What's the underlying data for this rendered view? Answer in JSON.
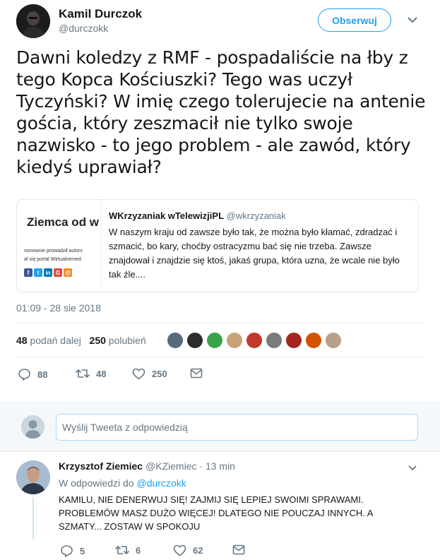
{
  "tweet": {
    "author_name": "Kamil Durczok",
    "author_handle": "@durczokk",
    "follow_label": "Obserwuj",
    "text": "Dawni koledzy z RMF - pospadaliście na łby z tego Kopca Kościuszki? Tego was uczył Tyczyński? W imię czego tolerujecie na antenie gościa, który zeszmacił nie tylko swoje nazwisko - to jego problem - ale zawód, który kiedyś uprawiał?",
    "timestamp": "01:09 - 28 sie 2018",
    "retweets_count": "48",
    "retweets_label": "podań dalej",
    "likes_count": "250",
    "likes_label": "polubień",
    "actions": {
      "replies": "88",
      "retweets": "48",
      "likes": "250"
    }
  },
  "quoted": {
    "thumbnail_title": "Ziemca od w",
    "thumbnail_line1": "nonownie prowadził autors",
    "thumbnail_line2": "al się portal Wirtualnemed",
    "author_name": "WKrzyzaniak wTelewizjiPL",
    "author_handle": "@wkrzyzaniak",
    "text": "W naszym kraju od zawsze było tak, że można było kłamać, zdradzać i szmacić, bo kary, choćby ostracyzmu bać się nie trzeba. Zawsze znajdował i znajdzie się ktoś, jakaś grupa, która uzna, że wcale nie było tak źle...."
  },
  "reply_box": {
    "placeholder": "Wyślij Tweeta z odpowiedzią"
  },
  "reply": {
    "author_name": "Krzysztof Ziemiec",
    "author_handle": "@KZiemiec",
    "time": "· 13 min",
    "in_reply_prefix": "W odpowiedzi do",
    "in_reply_handle": "@durczokk",
    "text": "KAMILU, NIE DENERWUJ SIĘ! ZAJMIJ SIĘ LEPIEJ SWOIMI SPRAWAMI. PROBLEMÓW MASZ DUŻO WIĘCEJ! DLATEGO NIE POUCZAJ INNYCH. A SZMATY... ZOSTAW  W SPOKOJU",
    "actions": {
      "replies": "5",
      "retweets": "6",
      "likes": "62"
    }
  },
  "colors": {
    "accent": "#1da1f2",
    "muted": "#657786",
    "text": "#14171a",
    "divider": "#e6ecf0"
  }
}
